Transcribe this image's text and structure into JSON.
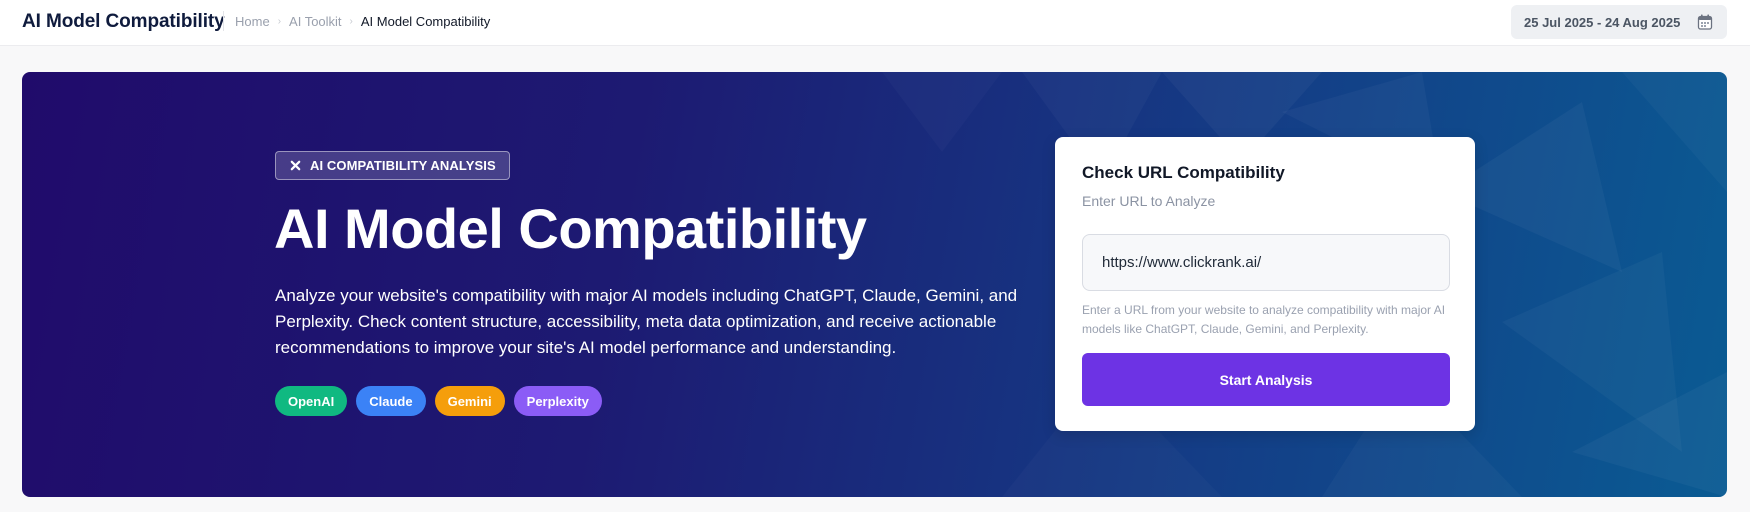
{
  "header": {
    "app_title": "AI Model Compatibility",
    "breadcrumb": [
      {
        "label": "Home"
      },
      {
        "label": "AI Toolkit"
      },
      {
        "label": "AI Model Compatibility"
      }
    ],
    "date_range": "25 Jul 2025 - 24 Aug 2025",
    "calendar_icon": "calendar-icon"
  },
  "hero": {
    "badge_icon": "close-icon",
    "badge_label": "AI COMPATIBILITY ANALYSIS",
    "title": "AI Model Compatibility",
    "description": "Analyze your website's compatibility with major AI models including ChatGPT, Claude, Gemini, and Perplexity. Check content structure, accessibility, meta data optimization, and receive actionable recommendations to improve your site's AI model performance and understanding.",
    "models": [
      {
        "label": "OpenAI",
        "color": "#10b981"
      },
      {
        "label": "Claude",
        "color": "#3b82f6"
      },
      {
        "label": "Gemini",
        "color": "#f59e0b"
      },
      {
        "label": "Perplexity",
        "color": "#8b5cf6"
      }
    ]
  },
  "url_card": {
    "title": "Check URL Compatibility",
    "label": "Enter URL to Analyze",
    "input_value": "https://www.clickrank.ai/",
    "help_text": "Enter a URL from your website to analyze compatibility with major AI models like ChatGPT, Claude, Gemini, and Perplexity.",
    "button_label": "Start Analysis",
    "button_color": "#6d33e4"
  },
  "colors": {
    "hero_gradient_start": "#200b6b",
    "hero_gradient_end": "#0a5b93"
  }
}
